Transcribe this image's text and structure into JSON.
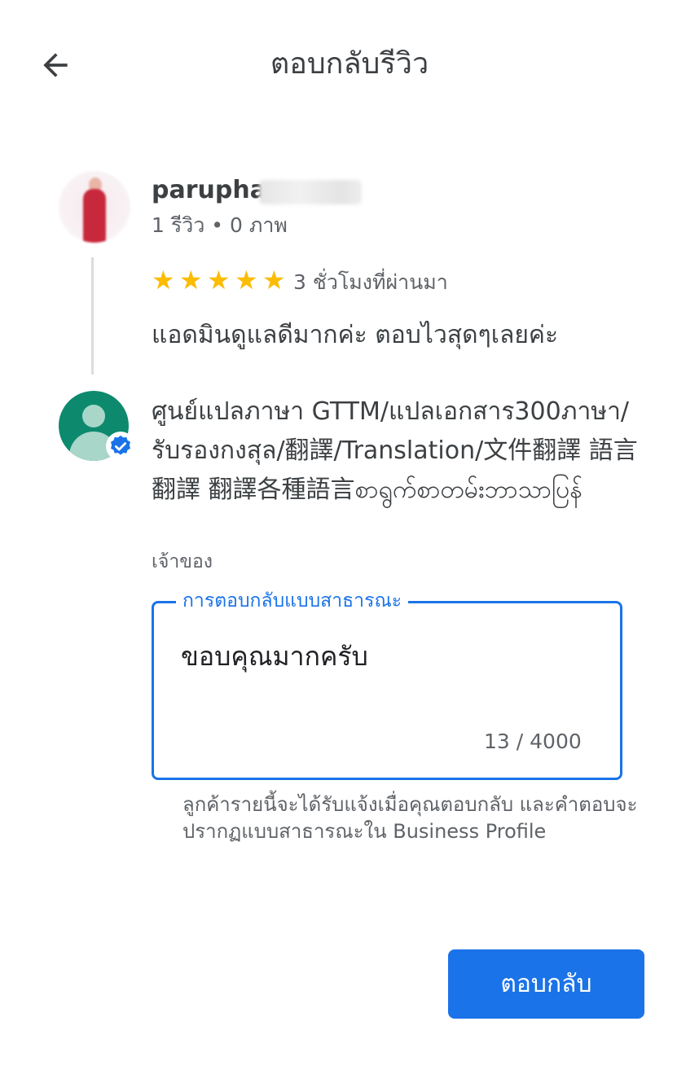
{
  "header": {
    "back_icon": "arrow-back-icon",
    "title": "ตอบกลับรีวิว"
  },
  "review": {
    "reviewer_name": "parupha",
    "reviewer_meta": "1 รีวิว • 0 ภาพ",
    "rating": 5,
    "rating_max": 5,
    "time": "3 ชั่วโมงที่ผ่านมา",
    "text": "แอดมินดูแลดีมากค่ะ ตอบไวสุดๆเลยค่ะ"
  },
  "owner": {
    "name": "ศูนย์แปลภาษา GTTM/แปลเอกสาร300ภาษา/รับรองกงสุล/翻譯/Translation/文件翻譯 語言翻譯 翻譯各種語言စာရွက်စာတမ်းဘာသာပြန်",
    "role": "เจ้าของ",
    "verified_icon": "verified-check-icon"
  },
  "reply": {
    "label": "การตอบกลับแบบสาธารณะ",
    "value": "ขอบคุณมากครับ",
    "char_count": "13 / 4000"
  },
  "helper_text": "ลูกค้ารายนี้จะได้รับแจ้งเมื่อคุณตอบกลับ และคำตอบจะปรากฏแบบสาธารณะใน Business Profile",
  "submit": {
    "label": "ตอบกลับ"
  },
  "colors": {
    "accent": "#1a73e8",
    "star": "#fbbc04",
    "owner_avatar": "#0d8a6e"
  }
}
